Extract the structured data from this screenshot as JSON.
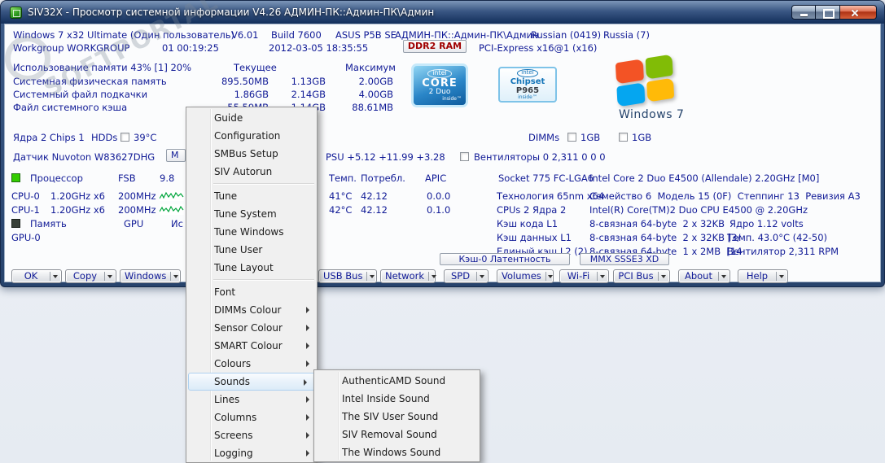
{
  "colors": {
    "text": "#101a96",
    "ddr2_text": "#a00000",
    "indicator_green": "#33cc00",
    "menu_highlight": "#dcebf8"
  },
  "watermark": {
    "text": "SOFTPORTAL"
  },
  "window": {
    "title": "SIV32X - Просмотр системной информации V4.26 АДМИН-ПК::Админ-ПК\\Админ"
  },
  "header": {
    "os": "Windows 7 x32 Ultimate (Один пользователь)",
    "version": "V6.01",
    "build": "Build 7600",
    "motherboard": "ASUS P5B SE",
    "computer": "АДМИН-ПК::Админ-ПК\\Админ",
    "language": "Russian (0419)",
    "country": "Russia (7)",
    "workgroup": "Workgroup WORKGROUP",
    "uptime": "01 00:19:25",
    "datetime": "2012-03-05 18:35:55",
    "memory_type_button": "DDR2 RAM",
    "pci_express": "PCI-Express x16@1 (x16)"
  },
  "memory": {
    "usage": "Использование памяти 43% [1] 20%",
    "col_current": "Текущее",
    "col_max": "Максимум",
    "rows": [
      {
        "label": "Системная физическая память",
        "current": "895.50MB",
        "peak": "1.13GB",
        "max": "2.00GB"
      },
      {
        "label": "Системный файл подкачки",
        "current": "1.86GB",
        "peak": "2.14GB",
        "max": "4.00GB"
      },
      {
        "label": "Файл системного кэша",
        "current": "55.59MB",
        "peak": "1.14GB",
        "max": "88.61MB"
      }
    ]
  },
  "logos": {
    "core": {
      "intel": "intel",
      "line1": "CORE",
      "line2": "2 Duo",
      "inside": "inside™"
    },
    "chipset": {
      "intel": "intel",
      "line1": "Chipset",
      "line2": "P965",
      "inside": "inside™"
    },
    "windows": {
      "caption": "Windows 7"
    }
  },
  "sensors": {
    "cores": "Ядра 2 Chips 1",
    "hdds": "HDDs",
    "hdd_temp": "39°C",
    "dimms": "DIMMs",
    "dimm1": "1GB",
    "dimm2": "1GB",
    "chip": "Датчик Nuvoton W83627DHG",
    "partial_button": "М",
    "psu": "PSU +5.12 +11.99 +3.28",
    "fans": "Вентиляторы 0 2,311 0 0 0"
  },
  "cpu": {
    "h_processor": "Процессор",
    "h_fsb": "FSB",
    "h_graph": "9.8",
    "h_temp": "Темп.",
    "h_power": "Потребл.",
    "h_apic": "APIC",
    "h_socket": "Socket 775 FC-LGA6",
    "h_model": "Intel Core 2 Duo E4500 (Allendale) 2.20GHz [M0]",
    "rows": [
      {
        "name": "CPU-0",
        "clock": "1.20GHz x6",
        "fsb": "200MHz",
        "temp": "41°C",
        "power": "42.12",
        "apic": "0.0.0",
        "info": "Технология 65nm x64",
        "detail": "Семейство 6  Модель 15 (0F)  Степпинг 13  Ревизия A3"
      },
      {
        "name": "CPU-1",
        "clock": "1.20GHz x6",
        "fsb": "200MHz",
        "temp": "42°C",
        "power": "42.12",
        "apic": "0.1.0",
        "info": "CPUs 2 Ядра 2",
        "detail": "Intel(R) Core(TM)2 Duo CPU E4500 @ 2.20GHz"
      }
    ],
    "memory_row": {
      "name": "Память",
      "gpu": "GPU",
      "partial": "Ис"
    },
    "gpu_row": {
      "name": "GPU-0"
    },
    "cache": [
      {
        "name": "Кэш кода L1",
        "value": "8-связная 64-byte  2 x 32KB",
        "extra": "Ядро 1.12 volts"
      },
      {
        "name": "Кэш данных L1",
        "value": "8-связная 64-byte  2 x 32KB [3/",
        "extra": "Темп. 43.0°C (42-50)"
      },
      {
        "name": "Единый кэш L2 (2)",
        "value": "8-связная 64-byte  1 x 2MB  [14",
        "extra": "Вентилятор 2,311 RPM"
      }
    ],
    "latency_button": "Кэш-0 Латентность",
    "mmx_button": "MMX SSSE3 XD"
  },
  "toolbar": {
    "buttons": [
      "OK",
      "Copy",
      "Windows",
      "USB Bus",
      "Network",
      "SPD",
      "Volumes",
      "Wi-Fi",
      "PCI Bus",
      "About",
      "Help"
    ]
  },
  "menu": {
    "items": [
      {
        "label": "Guide"
      },
      {
        "label": "Configuration"
      },
      {
        "label": "SMBus Setup"
      },
      {
        "label": "SIV Autorun"
      },
      {
        "label": "Tune"
      },
      {
        "label": "Tune System"
      },
      {
        "label": "Tune Windows"
      },
      {
        "label": "Tune User"
      },
      {
        "label": "Tune Layout"
      },
      {
        "label": "Font"
      },
      {
        "label": "DIMMs Colour"
      },
      {
        "label": "Sensor Colour"
      },
      {
        "label": "SMART Colour"
      },
      {
        "label": "Colours"
      },
      {
        "label": "Sounds"
      },
      {
        "label": "Lines"
      },
      {
        "label": "Columns"
      },
      {
        "label": "Screens"
      },
      {
        "label": "Logging"
      }
    ]
  },
  "submenu": {
    "items": [
      "AuthenticAMD Sound",
      "Intel Inside Sound",
      "The SIV User Sound",
      "SIV Removal Sound",
      "The Windows Sound"
    ]
  }
}
